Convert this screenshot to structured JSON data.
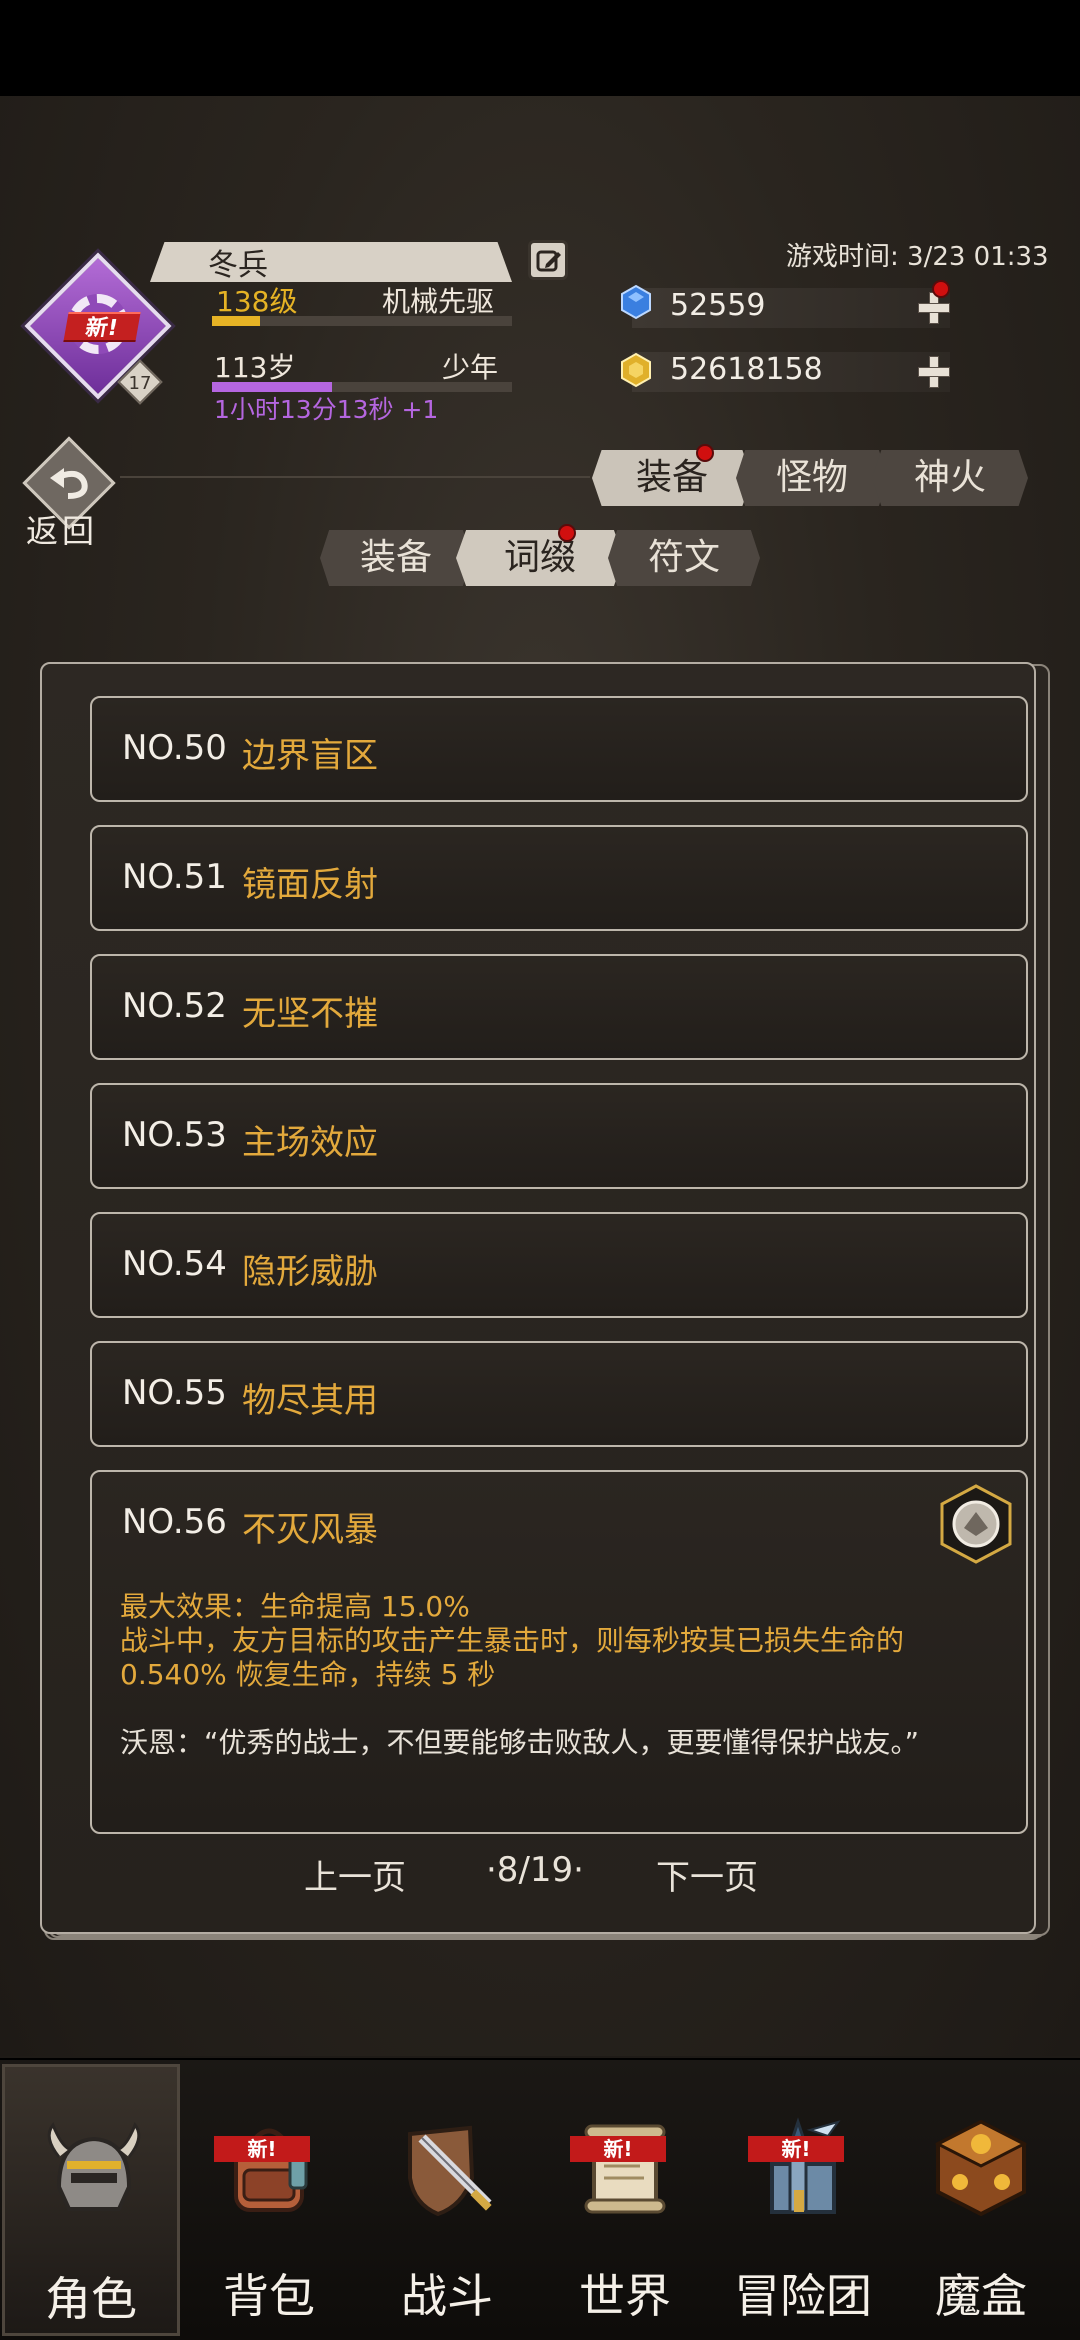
{
  "player": {
    "name": "冬兵",
    "level": "138级",
    "job": "机械先驱",
    "age": "113岁",
    "stage": "少年",
    "timer": "1小时13分13秒 +1",
    "avatar_badge": "新!",
    "avatar_level": "17"
  },
  "game_time": "游戏时间: 3/23 01:33",
  "currencies": {
    "diamond": "52559",
    "gold": "52618158"
  },
  "back_label": "返回",
  "tabs_main": [
    {
      "label": "装备",
      "active": true
    },
    {
      "label": "怪物",
      "active": false
    },
    {
      "label": "神火",
      "active": false
    }
  ],
  "tabs_sub": [
    {
      "label": "装备",
      "active": false
    },
    {
      "label": "词缀",
      "active": true
    },
    {
      "label": "符文",
      "active": false
    }
  ],
  "entries": [
    {
      "no": "NO.50",
      "title": "边界盲区"
    },
    {
      "no": "NO.51",
      "title": "镜面反射"
    },
    {
      "no": "NO.52",
      "title": "无坚不摧"
    },
    {
      "no": "NO.53",
      "title": "主场效应"
    },
    {
      "no": "NO.54",
      "title": "隐形威胁"
    },
    {
      "no": "NO.55",
      "title": "物尽其用"
    },
    {
      "no": "NO.56",
      "title": "不灭风暴"
    }
  ],
  "expanded": {
    "line1": "最大效果：生命提高 15.0%",
    "line2": "战斗中，友方目标的攻击产生暴击时，则每秒按其已损失生命的",
    "line3": "0.540% 恢复生命，持续 5 秒",
    "quote": "沃恩：“优秀的战士，不但要能够击败敌人，更要懂得保护战友。”"
  },
  "pager": {
    "prev": "上一页",
    "page": "·8/19·",
    "next": "下一页"
  },
  "nav": [
    {
      "label": "角色",
      "new": false,
      "active": true
    },
    {
      "label": "背包",
      "new": true,
      "active": false
    },
    {
      "label": "战斗",
      "new": false,
      "active": false
    },
    {
      "label": "世界",
      "new": true,
      "active": false
    },
    {
      "label": "冒险团",
      "new": true,
      "active": false
    },
    {
      "label": "魔盒",
      "new": false,
      "active": false
    }
  ],
  "new_badge": "新!",
  "colors": {
    "accent_gold": "#e3a93c",
    "level_yellow": "#e6b325",
    "timer_purple": "#b566e0",
    "red_dot": "#d10f0f"
  }
}
